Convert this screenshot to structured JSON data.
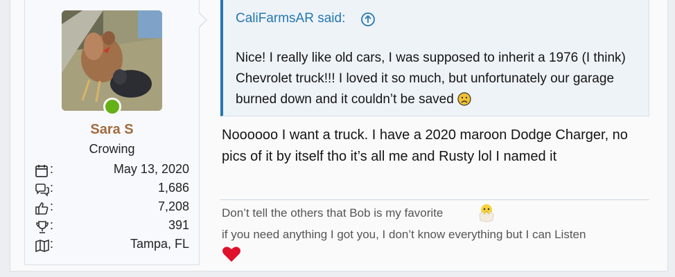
{
  "user": {
    "name": "Sara S",
    "title": "Crowing",
    "online_color": "#63b117",
    "stats": [
      {
        "icon": "calendar-icon",
        "value": "May 13, 2020"
      },
      {
        "icon": "messages-icon",
        "value": "1,686"
      },
      {
        "icon": "thumbs-up-icon",
        "value": "7,208"
      },
      {
        "icon": "trophy-icon",
        "value": "391"
      },
      {
        "icon": "map-icon",
        "value": "Tampa, FL"
      }
    ],
    "colon": ":"
  },
  "quote": {
    "author": "CaliFarmsAR said:",
    "text": "Nice! I really like old cars, I was supposed to inherit a 1976 (I think) Chevrolet truck!!! I loved it so much, but unfortunately our garage burned down and it couldn’t be saved"
  },
  "post": {
    "body": "Noooooo I want a truck. I have a 2020 maroon Dodge Charger, no pics of it by itself tho it’s all me and Rusty lol I named it"
  },
  "signature": {
    "line1": "Don’t tell the others that Bob is my favorite",
    "line2": "if you need anything I got you, I don’t know everything but I can Listen"
  },
  "colors": {
    "accent": "#2577b1",
    "username": "#a36b3e",
    "heart": "#e0112b"
  }
}
